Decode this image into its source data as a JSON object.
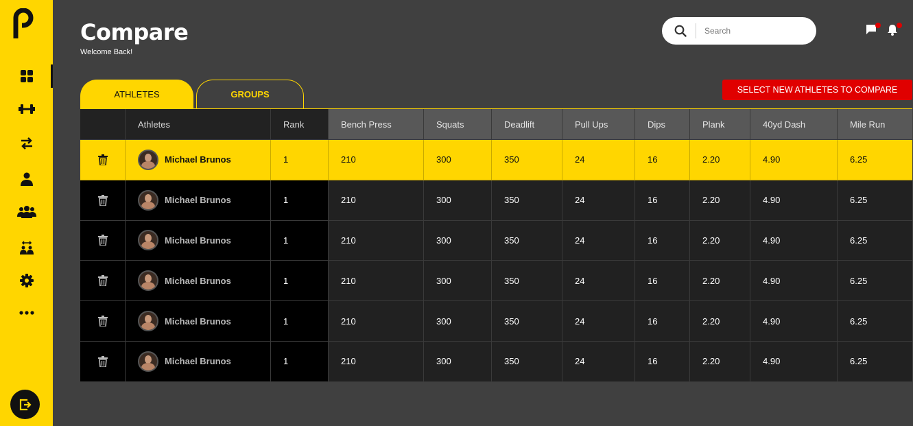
{
  "header": {
    "title": "Compare",
    "subtitle": "Welcome Back!",
    "search_placeholder": "Search"
  },
  "tabs": [
    {
      "label": "ATHLETES",
      "active": true
    },
    {
      "label": "GROUPS",
      "active": false
    }
  ],
  "cta_label": "SELECT NEW ATHLETES TO COMPARE",
  "sidebar": {
    "items": [
      "dashboard-icon",
      "dumbbell-icon",
      "compare-arrows-icon",
      "user-icon",
      "group-icon",
      "team-swap-icon",
      "gear-icon",
      "more-icon"
    ],
    "active": "dashboard-icon",
    "logout": "logout-icon"
  },
  "colors": {
    "accent": "#FFD600",
    "danger": "#E00000",
    "background": "#404040"
  },
  "table": {
    "columns": [
      "",
      "Athletes",
      "Rank",
      "Bench Press",
      "Squats",
      "Deadlift",
      "Pull Ups",
      "Dips",
      "Plank",
      "40yd Dash",
      "Mile Run"
    ],
    "rows": [
      {
        "name": "Michael Brunos",
        "rank": "1",
        "bench": "210",
        "squats": "300",
        "deadlift": "350",
        "pullups": "24",
        "dips": "16",
        "plank": "2.20",
        "dash": "4.90",
        "mile": "6.25",
        "selected": true
      },
      {
        "name": "Michael Brunos",
        "rank": "1",
        "bench": "210",
        "squats": "300",
        "deadlift": "350",
        "pullups": "24",
        "dips": "16",
        "plank": "2.20",
        "dash": "4.90",
        "mile": "6.25",
        "selected": false
      },
      {
        "name": "Michael Brunos",
        "rank": "1",
        "bench": "210",
        "squats": "300",
        "deadlift": "350",
        "pullups": "24",
        "dips": "16",
        "plank": "2.20",
        "dash": "4.90",
        "mile": "6.25",
        "selected": false
      },
      {
        "name": "Michael Brunos",
        "rank": "1",
        "bench": "210",
        "squats": "300",
        "deadlift": "350",
        "pullups": "24",
        "dips": "16",
        "plank": "2.20",
        "dash": "4.90",
        "mile": "6.25",
        "selected": false
      },
      {
        "name": "Michael Brunos",
        "rank": "1",
        "bench": "210",
        "squats": "300",
        "deadlift": "350",
        "pullups": "24",
        "dips": "16",
        "plank": "2.20",
        "dash": "4.90",
        "mile": "6.25",
        "selected": false
      },
      {
        "name": "Michael Brunos",
        "rank": "1",
        "bench": "210",
        "squats": "300",
        "deadlift": "350",
        "pullups": "24",
        "dips": "16",
        "plank": "2.20",
        "dash": "4.90",
        "mile": "6.25",
        "selected": false
      }
    ]
  }
}
